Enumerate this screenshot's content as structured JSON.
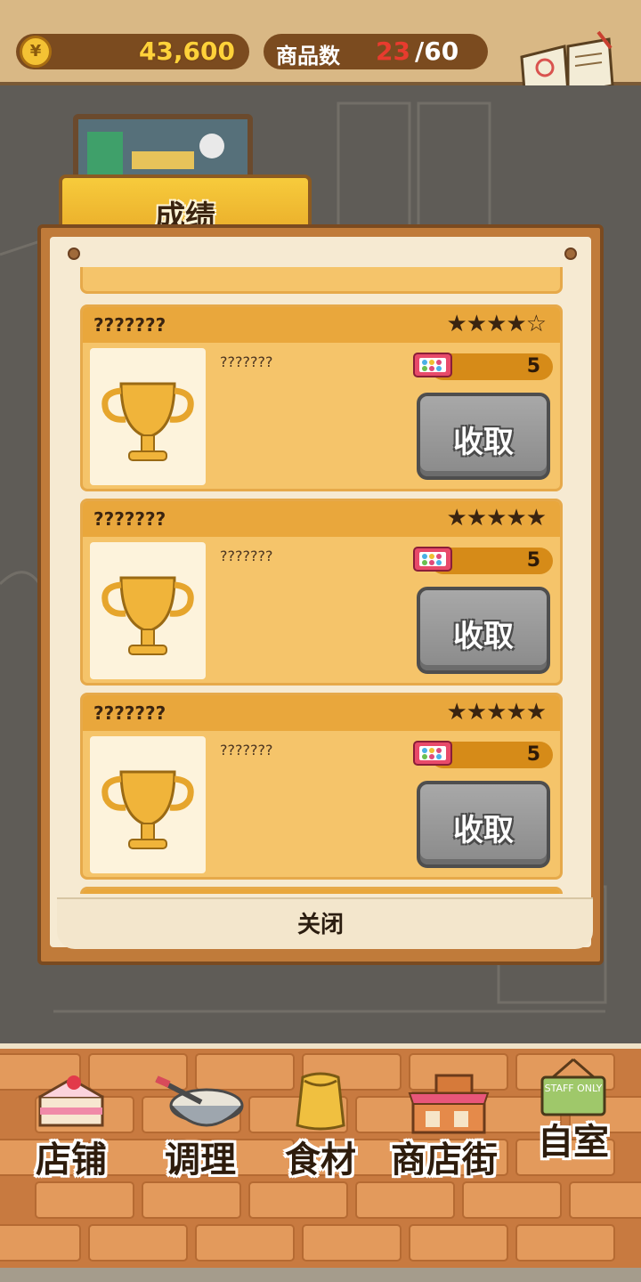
{
  "header": {
    "coin_symbol": "¥",
    "coins": "43,600",
    "product_label": "商品数",
    "product_current": "23",
    "product_max": "/60",
    "recipe_label": "食谱"
  },
  "panel": {
    "tab_title": "成绩",
    "close_label": "关闭",
    "achievements": [
      {
        "title": "???????",
        "stars": "★★★★☆",
        "description": "???????",
        "reward": "5",
        "button": "收取"
      },
      {
        "title": "???????",
        "stars": "★★★★★",
        "description": "???????",
        "reward": "5",
        "button": "收取"
      },
      {
        "title": "???????",
        "stars": "★★★★★",
        "description": "???????",
        "reward": "5",
        "button": "收取"
      }
    ]
  },
  "nav": {
    "items": [
      {
        "label": "店铺",
        "icon": "cake-icon"
      },
      {
        "label": "调理",
        "icon": "mixing-bowl-icon"
      },
      {
        "label": "食材",
        "icon": "flour-sack-icon"
      },
      {
        "label": "商店街",
        "icon": "shop-icon"
      },
      {
        "label": "自室",
        "icon": "staff-only-sign-icon",
        "sign_text": "STAFF ONLY"
      }
    ]
  },
  "colors": {
    "accent_gold": "#f4c234",
    "card_bg": "#f5c46a",
    "card_head": "#e9a73c",
    "button_gray": "#9a9a9a",
    "brick": "#d6874a"
  }
}
